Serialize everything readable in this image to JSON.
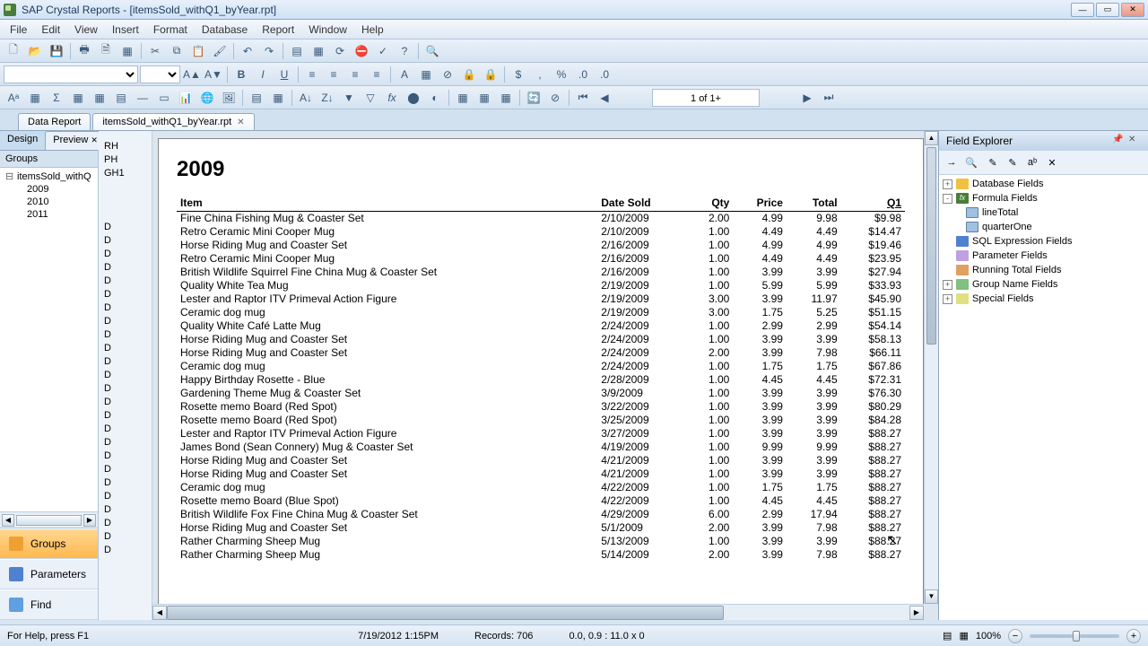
{
  "app": {
    "title": "SAP Crystal Reports - [itemsSold_withQ1_byYear.rpt]"
  },
  "menus": [
    "File",
    "Edit",
    "View",
    "Insert",
    "Format",
    "Database",
    "Report",
    "Window",
    "Help"
  ],
  "pageIndicator": "1 of 1+",
  "docTabs": [
    {
      "label": "Data Report",
      "active": false
    },
    {
      "label": "itemsSold_withQ1_byYear.rpt",
      "active": true
    }
  ],
  "viewTabs": [
    {
      "label": "Design",
      "active": false
    },
    {
      "label": "Preview",
      "active": true,
      "closable": true
    }
  ],
  "groupsPanel": {
    "header": "Groups",
    "root": "itemsSold_withQ",
    "years": [
      "2009",
      "2010",
      "2011"
    ]
  },
  "sideButtons": [
    {
      "label": "Groups",
      "icon": "groups",
      "active": true
    },
    {
      "label": "Parameters",
      "icon": "params",
      "active": false
    },
    {
      "label": "Find",
      "icon": "find",
      "active": false
    }
  ],
  "sectionGutter": {
    "headers": [
      "RH",
      "PH",
      "GH1"
    ],
    "detailMark": "D",
    "detailCount": 25
  },
  "report": {
    "groupTitle": "2009",
    "columns": [
      "Item",
      "Date Sold",
      "Qty",
      "Price",
      "Total",
      "Q1"
    ],
    "rows": [
      [
        "Fine China Fishing Mug & Coaster Set",
        "2/10/2009",
        "2.00",
        "4.99",
        "9.98",
        "$9.98"
      ],
      [
        "Retro Ceramic Mini Cooper Mug",
        "2/10/2009",
        "1.00",
        "4.49",
        "4.49",
        "$14.47"
      ],
      [
        "Horse Riding Mug and Coaster Set",
        "2/16/2009",
        "1.00",
        "4.99",
        "4.99",
        "$19.46"
      ],
      [
        "Retro Ceramic Mini Cooper Mug",
        "2/16/2009",
        "1.00",
        "4.49",
        "4.49",
        "$23.95"
      ],
      [
        "British Wildlife Squirrel Fine China Mug & Coaster Set",
        "2/16/2009",
        "1.00",
        "3.99",
        "3.99",
        "$27.94"
      ],
      [
        "Quality White Tea Mug",
        "2/19/2009",
        "1.00",
        "5.99",
        "5.99",
        "$33.93"
      ],
      [
        "Lester and Raptor ITV Primeval Action Figure",
        "2/19/2009",
        "3.00",
        "3.99",
        "11.97",
        "$45.90"
      ],
      [
        "Ceramic dog mug",
        "2/19/2009",
        "3.00",
        "1.75",
        "5.25",
        "$51.15"
      ],
      [
        "Quality White Café Latte Mug",
        "2/24/2009",
        "1.00",
        "2.99",
        "2.99",
        "$54.14"
      ],
      [
        "Horse Riding Mug and Coaster Set",
        "2/24/2009",
        "1.00",
        "3.99",
        "3.99",
        "$58.13"
      ],
      [
        "Horse Riding Mug and Coaster Set",
        "2/24/2009",
        "2.00",
        "3.99",
        "7.98",
        "$66.11"
      ],
      [
        "Ceramic dog mug",
        "2/24/2009",
        "1.00",
        "1.75",
        "1.75",
        "$67.86"
      ],
      [
        "Happy Birthday Rosette - Blue",
        "2/28/2009",
        "1.00",
        "4.45",
        "4.45",
        "$72.31"
      ],
      [
        "Gardening Theme Mug & Coaster Set",
        "3/9/2009",
        "1.00",
        "3.99",
        "3.99",
        "$76.30"
      ],
      [
        "Rosette memo Board (Red Spot)",
        "3/22/2009",
        "1.00",
        "3.99",
        "3.99",
        "$80.29"
      ],
      [
        "Rosette memo Board (Red Spot)",
        "3/25/2009",
        "1.00",
        "3.99",
        "3.99",
        "$84.28"
      ],
      [
        "Lester and Raptor ITV Primeval Action Figure",
        "3/27/2009",
        "1.00",
        "3.99",
        "3.99",
        "$88.27"
      ],
      [
        "James Bond (Sean Connery) Mug & Coaster Set",
        "4/19/2009",
        "1.00",
        "9.99",
        "9.99",
        "$88.27"
      ],
      [
        "Horse Riding Mug and Coaster Set",
        "4/21/2009",
        "1.00",
        "3.99",
        "3.99",
        "$88.27"
      ],
      [
        "Horse Riding Mug and Coaster Set",
        "4/21/2009",
        "1.00",
        "3.99",
        "3.99",
        "$88.27"
      ],
      [
        "Ceramic dog mug",
        "4/22/2009",
        "1.00",
        "1.75",
        "1.75",
        "$88.27"
      ],
      [
        "Rosette memo Board (Blue Spot)",
        "4/22/2009",
        "1.00",
        "4.45",
        "4.45",
        "$88.27"
      ],
      [
        "British Wildlife Fox Fine China Mug & Coaster Set",
        "4/29/2009",
        "6.00",
        "2.99",
        "17.94",
        "$88.27"
      ],
      [
        "Horse Riding Mug and Coaster Set",
        "5/1/2009",
        "2.00",
        "3.99",
        "7.98",
        "$88.27"
      ],
      [
        "Rather Charming Sheep Mug",
        "5/13/2009",
        "1.00",
        "3.99",
        "3.99",
        "$88.27"
      ],
      [
        "Rather Charming Sheep Mug",
        "5/14/2009",
        "2.00",
        "3.99",
        "7.98",
        "$88.27"
      ]
    ]
  },
  "fieldExplorer": {
    "title": "Field Explorer",
    "items": [
      {
        "label": "Database Fields",
        "icon": "db",
        "level": 1,
        "exp": "+"
      },
      {
        "label": "Formula Fields",
        "icon": "fx",
        "level": 1,
        "exp": "-"
      },
      {
        "label": "lineTotal",
        "icon": "field",
        "level": 2
      },
      {
        "label": "quarterOne",
        "icon": "field",
        "level": 2
      },
      {
        "label": "SQL Expression Fields",
        "icon": "sql",
        "level": 1
      },
      {
        "label": "Parameter Fields",
        "icon": "param",
        "level": 1
      },
      {
        "label": "Running Total Fields",
        "icon": "running",
        "level": 1
      },
      {
        "label": "Group Name Fields",
        "icon": "group",
        "level": 1,
        "exp": "+"
      },
      {
        "label": "Special Fields",
        "icon": "special",
        "level": 1,
        "exp": "+"
      }
    ]
  },
  "status": {
    "help": "For Help, press F1",
    "datetime": "7/19/2012  1:15PM",
    "records": "Records: 706",
    "coords": "0.0, 0.9 : 11.0 x 0",
    "zoom": "100%"
  }
}
